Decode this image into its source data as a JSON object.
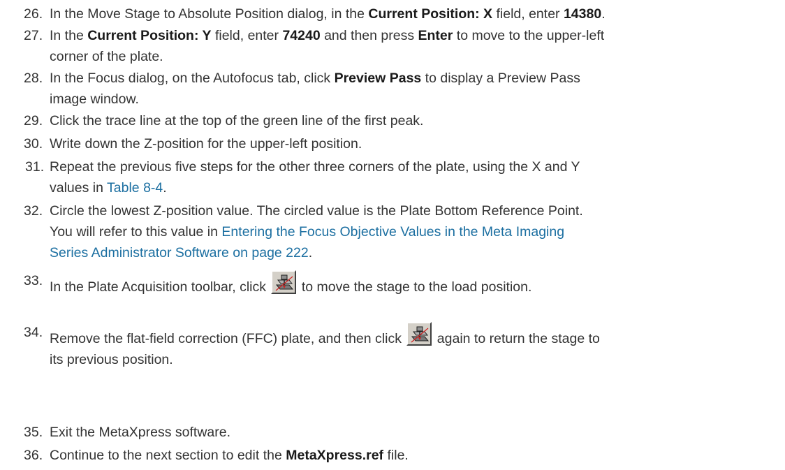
{
  "steps": [
    {
      "num": "26.",
      "parts": [
        "In the Move Stage to Absolute Position dialog, in the ",
        "Current Position: X",
        " field, enter ",
        "14380",
        "."
      ]
    },
    {
      "num": "27.",
      "line1": [
        "In the ",
        "Current Position: Y",
        " field, enter ",
        "74240",
        " and then press ",
        "Enter",
        " to move to the upper-left"
      ],
      "line2": "corner of the plate."
    },
    {
      "num": "28.",
      "line1": [
        "In the Focus dialog, on the Autofocus tab, click ",
        "Preview Pass",
        " to display a Preview Pass"
      ],
      "line2": "image window."
    },
    {
      "num": "29.",
      "text": "Click the trace line at the top of the green line of the first peak."
    },
    {
      "num": "30.",
      "text": "Write down the Z-position for the upper-left position."
    },
    {
      "num": "31.",
      "line1": "Repeat the previous five steps for the other three corners of the plate, using the X and Y",
      "line2_pre": "values in ",
      "line2_link": "Table 8-4",
      "line2_post": "."
    },
    {
      "num": "32.",
      "line1": "Circle the lowest Z-position value. The circled value is the Plate Bottom Reference Point.",
      "line2_pre": "You will refer to this value in ",
      "line2_link": "Entering the Focus Objective Values in the Meta Imaging",
      "line3_link": "Series Administrator Software on page 222",
      "line3_post": "."
    },
    {
      "num": "33.",
      "pre": "In the Plate Acquisition toolbar, click ",
      "post": " to move the stage to the load position."
    },
    {
      "num": "34.",
      "pre": "Remove the flat-field correction (FFC) plate, and then click ",
      "post": " again to return the stage to",
      "line2": "its previous position."
    },
    {
      "num": "35.",
      "text": "Exit the MetaXpress software."
    },
    {
      "num": "36.",
      "parts": [
        "Continue to the next section to edit the ",
        "MetaXpress.ref",
        " file."
      ]
    }
  ],
  "icons": {
    "load_position": "stage-load-position-icon"
  },
  "colors": {
    "text": "#333333",
    "link": "#1c6fa1"
  }
}
